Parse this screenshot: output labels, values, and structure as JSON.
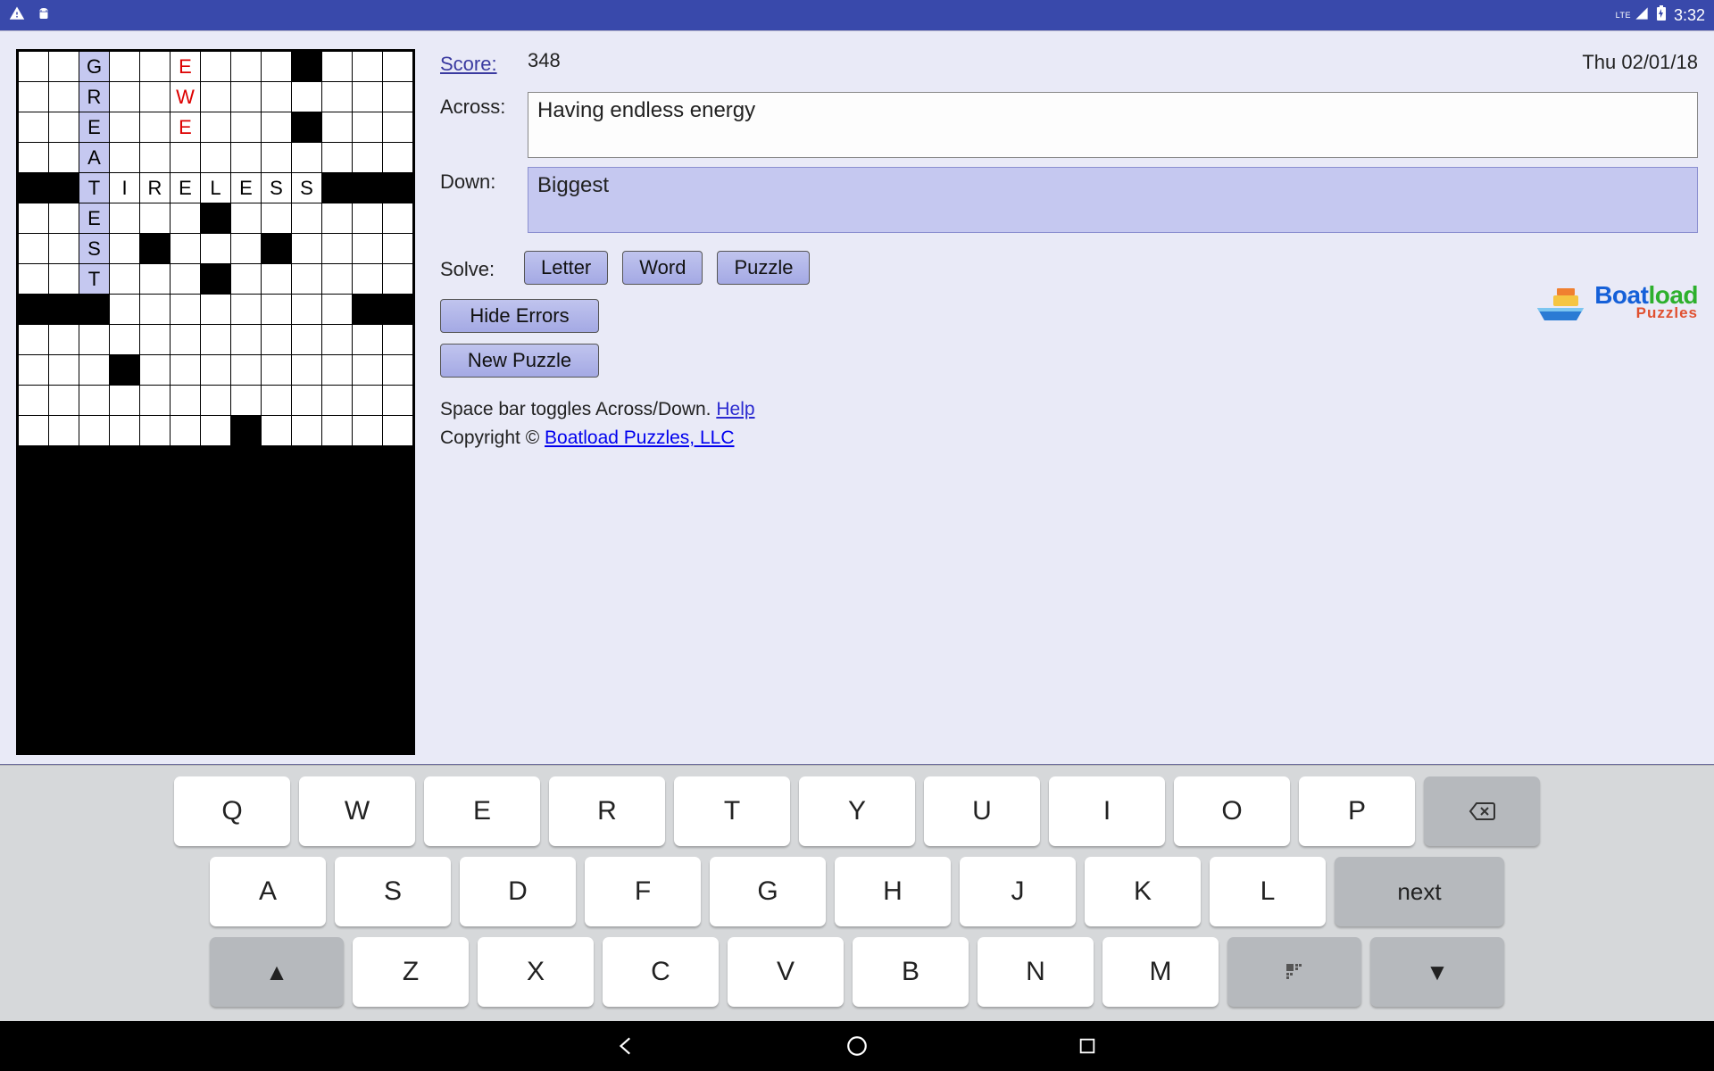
{
  "status": {
    "lte": "LTE",
    "time": "3:32"
  },
  "score_label": "Score:",
  "score_value": "348",
  "date": "Thu 02/01/18",
  "across_label": "Across:",
  "across_clue": "Having endless energy",
  "down_label": "Down:",
  "down_clue": "Biggest",
  "solve_label": "Solve:",
  "buttons": {
    "letter": "Letter",
    "word": "Word",
    "puzzle": "Puzzle",
    "hide_errors": "Hide Errors",
    "new_puzzle": "New Puzzle"
  },
  "hint_text": "Space bar toggles Across/Down. ",
  "help_link": "Help",
  "copyright_prefix": "Copyright © ",
  "copyright_link": "Boatload Puzzles, LLC",
  "logo": {
    "boat": "Boat",
    "load": "load",
    "sub": "Puzzles"
  },
  "grid": {
    "size": 13,
    "cells": [
      [
        "",
        "",
        {
          "l": "G",
          "hl": 1
        },
        "",
        "",
        {
          "l": "E",
          "err": 1
        },
        "",
        "",
        "",
        "B",
        "",
        "",
        ""
      ],
      [
        "",
        "",
        {
          "l": "R",
          "hl": 1
        },
        "",
        "",
        {
          "l": "W",
          "err": 1
        },
        "",
        "",
        "",
        "",
        "",
        "",
        ""
      ],
      [
        "",
        "",
        {
          "l": "E",
          "hl": 1
        },
        "",
        "",
        {
          "l": "E",
          "err": 1
        },
        "",
        "",
        "",
        "B",
        "",
        "",
        ""
      ],
      [
        "",
        "",
        {
          "l": "A",
          "hl": 1
        },
        "",
        "",
        "",
        "",
        "",
        "",
        "",
        "",
        "",
        ""
      ],
      [
        "B",
        "B",
        {
          "l": "T",
          "hl": 1
        },
        "I",
        "R",
        "E",
        "L",
        "E",
        "S",
        "S",
        "B",
        "B",
        "B"
      ],
      [
        "",
        "",
        {
          "l": "E",
          "hl": 1
        },
        "",
        "",
        "",
        "B",
        "",
        "",
        "",
        "",
        "",
        ""
      ],
      [
        "",
        "",
        {
          "l": "S",
          "hl": 1
        },
        "",
        "B",
        "",
        "",
        "",
        "B",
        "",
        "",
        "",
        ""
      ],
      [
        "",
        "",
        {
          "l": "T",
          "hl": 1
        },
        "",
        "",
        "",
        "B",
        "",
        "",
        "",
        "",
        "",
        ""
      ],
      [
        "B",
        "B",
        "B",
        "",
        "",
        "",
        "",
        "",
        "",
        "",
        "",
        "B",
        "B"
      ],
      [
        "",
        "",
        "",
        "",
        "",
        "",
        "",
        "",
        "",
        "",
        "",
        "",
        ""
      ],
      [
        "",
        "",
        "",
        "B",
        "",
        "",
        "",
        "",
        "",
        "",
        "",
        "",
        ""
      ],
      [
        "",
        "",
        "",
        "",
        "",
        "",
        "",
        "",
        "",
        "",
        "",
        "",
        ""
      ],
      [
        "",
        "",
        "",
        "",
        "",
        "",
        "",
        "B",
        "",
        "",
        "",
        "",
        ""
      ]
    ]
  },
  "keyboard": {
    "row1": [
      "Q",
      "W",
      "E",
      "R",
      "T",
      "Y",
      "U",
      "I",
      "O",
      "P"
    ],
    "row2": [
      "A",
      "S",
      "D",
      "F",
      "G",
      "H",
      "J",
      "K",
      "L"
    ],
    "next": "next",
    "row3": [
      "Z",
      "X",
      "C",
      "V",
      "B",
      "N",
      "M"
    ]
  }
}
